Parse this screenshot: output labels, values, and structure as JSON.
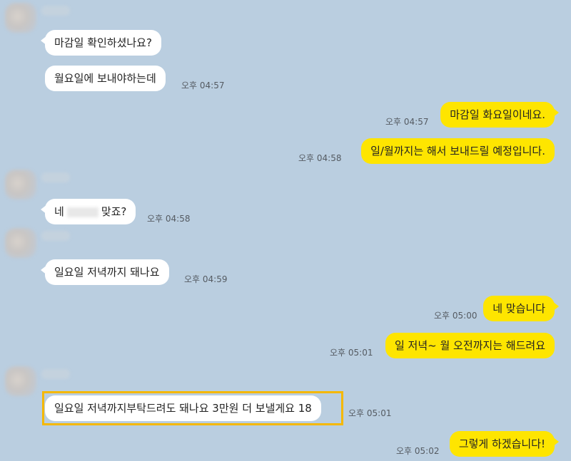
{
  "messages": {
    "m1": {
      "text": "마감일 확인하셨나요?",
      "time": ""
    },
    "m2": {
      "text": "월요일에 보내야하는데",
      "time": "오후 04:57"
    },
    "m3": {
      "text": "마감일 화요일이네요.",
      "time": "오후 04:57"
    },
    "m4": {
      "text": "일/월까지는 해서 보내드릴 예정입니다.",
      "time": "오후 04:58"
    },
    "m5": {
      "text_before": "네",
      "text_after": "맞죠?",
      "time": "오후 04:58"
    },
    "m6": {
      "text": "일요일 저녁까지 돼나요",
      "time": "오후 04:59"
    },
    "m7": {
      "text": "네 맞습니다",
      "time": "오후 05:00"
    },
    "m8": {
      "text": "일 저녁~ 월 오전까지는 해드려요",
      "time": "오후 05:01"
    },
    "m9": {
      "text": "일요일 저녁까지부탁드려도 돼나요 3만원 더 보낼게요 18",
      "time": "오후 05:01"
    },
    "m10": {
      "text": "그렇게 하겠습니다!",
      "time": "오후 05:02"
    }
  },
  "colors": {
    "background": "#bacee0",
    "incoming_bubble": "#ffffff",
    "outgoing_bubble": "#fee500",
    "highlight_border": "#f5b800"
  }
}
